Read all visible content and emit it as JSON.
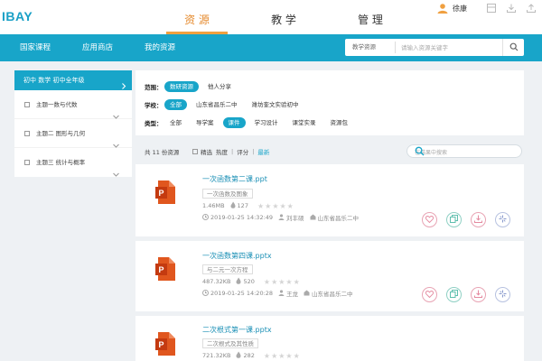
{
  "header": {
    "logo": "IBAY",
    "tabs": [
      {
        "label": "资 源",
        "active": true
      },
      {
        "label": "教 学",
        "active": false
      },
      {
        "label": "管 理",
        "active": false
      }
    ],
    "user_name": "徐康",
    "accent_color": "#18a5c9",
    "active_tab_color": "#e58a2d"
  },
  "nav": {
    "items": [
      "国家课程",
      "应用商店",
      "我的资源"
    ],
    "search": {
      "type_label": "教学资源",
      "placeholder": "请输入资源关键字"
    }
  },
  "sidebar": {
    "header": "初中 数学 初中全年级",
    "items": [
      {
        "label": "主题一数与代数"
      },
      {
        "label": "主题二 图形与几何"
      },
      {
        "label": "主题三 统计与概率"
      }
    ]
  },
  "filters": {
    "scope": {
      "label": "范围：",
      "options": [
        "数研资源",
        "他人分享"
      ],
      "selected": 0
    },
    "school": {
      "label": "学校：",
      "options": [
        "全部",
        "山东省昌乐二中",
        "潍坊奎文实验初中"
      ],
      "selected": 0
    },
    "type": {
      "label": "类型：",
      "options": [
        "全部",
        "导学案",
        "课件",
        "学习设计",
        "课堂实录",
        "资源包"
      ],
      "selected": 2
    }
  },
  "list": {
    "count_text": "共 11 份资源",
    "sort": {
      "selected": "精选",
      "hot": "热度",
      "rating": "评分",
      "latest": "最新"
    },
    "search_placeholder": "在结果中搜索"
  },
  "resources": [
    {
      "title": "一次函数第二课.ppt",
      "tag": "一次函数及图象",
      "size": "1.46MB",
      "downloads": "127",
      "date": "2019-01-25 14:32:49",
      "author": "刘丰硕",
      "school": "山东省昌乐二中",
      "rating": 0
    },
    {
      "title": "一次函数第四课.pptx",
      "tag": "与二元一次方程",
      "size": "487.32KB",
      "downloads": "520",
      "date": "2019-01-25 14:20:28",
      "author": "王龙",
      "school": "山东省昌乐二中",
      "rating": 0
    },
    {
      "title": "二次根式第一课.pptx",
      "tag": "二次根式及其性质",
      "size": "721.32KB",
      "downloads": "282",
      "rating": 0
    }
  ]
}
